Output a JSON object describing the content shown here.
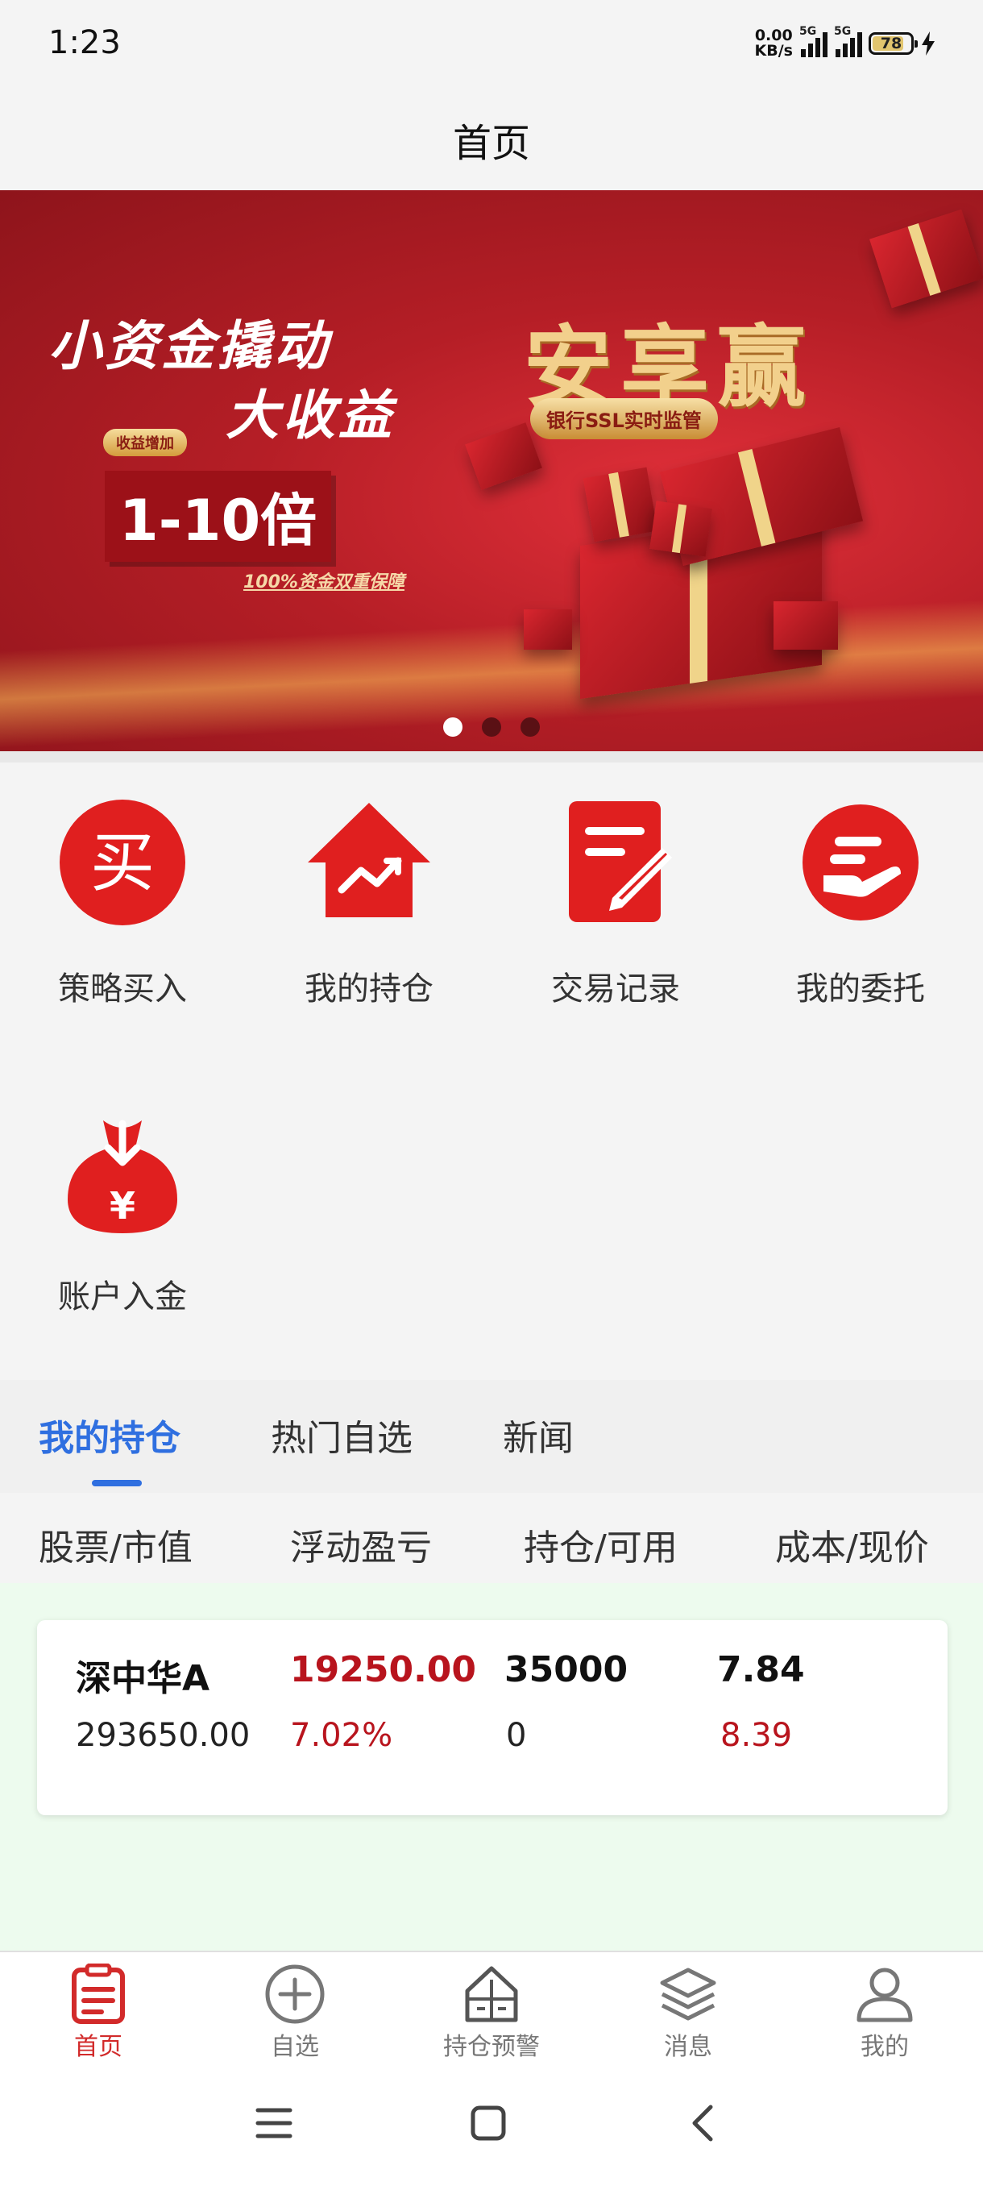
{
  "status": {
    "time": "1:23",
    "net_speed_top": "0.00",
    "net_speed_bottom": "KB/s",
    "sim1": "5G",
    "sim2": "5G",
    "battery": "78"
  },
  "header": {
    "title": "首页"
  },
  "banner": {
    "slogan_line1": "小资金撬动",
    "slogan_line2": "大收益",
    "badge": "收益增加",
    "multiple": "1-10倍",
    "guarantee": "100%资金双重保障",
    "headline": "安享赢",
    "pill": "银行SSL实时监管",
    "active_slide": 1,
    "slide_count": 3
  },
  "quick_actions": [
    {
      "label": "策略买入",
      "icon": "buy-icon"
    },
    {
      "label": "我的持仓",
      "icon": "house-chart-icon"
    },
    {
      "label": "交易记录",
      "icon": "record-edit-icon"
    },
    {
      "label": "我的委托",
      "icon": "hand-money-icon"
    },
    {
      "label": "账户入金",
      "icon": "money-bag-icon"
    }
  ],
  "tabs": {
    "items": [
      "我的持仓",
      "热门自选",
      "新闻"
    ],
    "active": "我的持仓"
  },
  "table_headers": [
    "股票/市值",
    "浮动盈亏",
    "持仓/可用",
    "成本/现价"
  ],
  "positions": [
    {
      "name": "深中华A",
      "market_value": "293650.00",
      "pnl": "19250.00",
      "pnl_pct": "7.02%",
      "holding": "35000",
      "available": "0",
      "cost": "7.84",
      "price": "8.39"
    }
  ],
  "bottom_nav": [
    {
      "label": "首页",
      "icon": "home-doc-icon"
    },
    {
      "label": "自选",
      "icon": "plus-circle-icon"
    },
    {
      "label": "持仓预警",
      "icon": "warning-house-icon"
    },
    {
      "label": "消息",
      "icon": "layers-icon"
    },
    {
      "label": "我的",
      "icon": "user-icon"
    }
  ],
  "colors": {
    "accent_red": "#e01f1f",
    "tab_blue": "#2f6fe0",
    "loss_red": "#b8141d",
    "list_bg": "#edfbee"
  }
}
